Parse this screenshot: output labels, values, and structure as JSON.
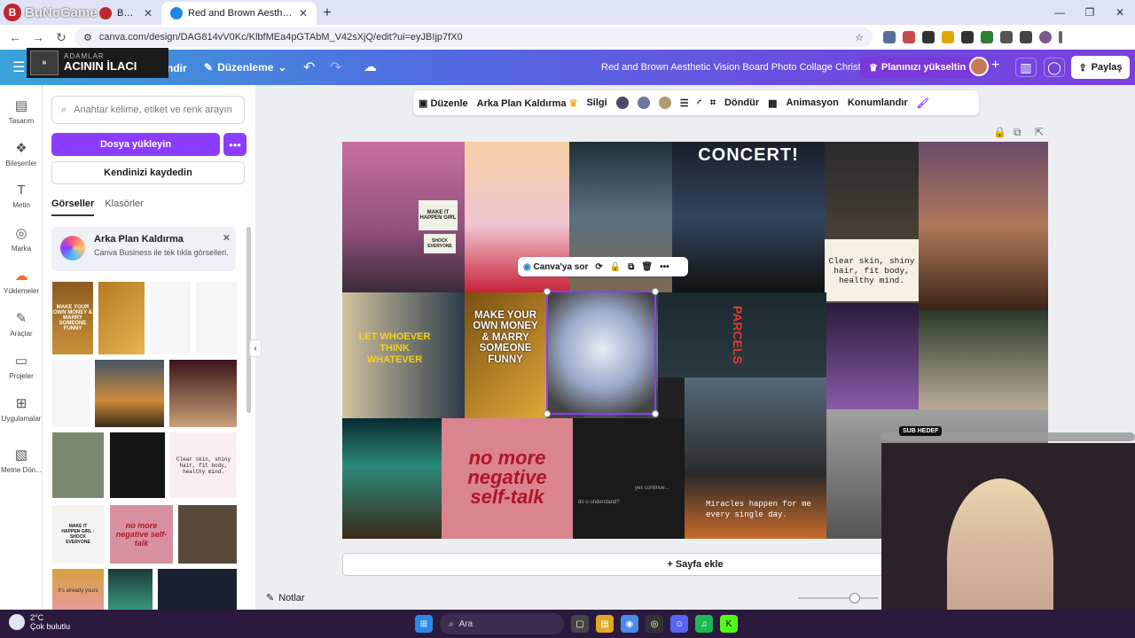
{
  "watermark": {
    "text": "BuNoGame"
  },
  "browser": {
    "tabs": [
      {
        "label": "BuNoGame",
        "active": false
      },
      {
        "label": "Red and Brown Aesthetic Vision",
        "active": true
      }
    ],
    "url": "canva.com/design/DAG814vV0Kc/KlbfMEa4pGTAbM_V42sXjQ/edit?ui=eyJBIjp7fX0"
  },
  "overlay": {
    "small": "ADAMLAR",
    "big": "ACININ İLACI"
  },
  "canva_top": {
    "file_label": "ndir",
    "edit_label": "Düzenleme",
    "doc_title": "Red and Brown Aesthetic Vision Board Photo Collage Christ...",
    "upgrade_label": "Planınızı yükseltin",
    "share_label": "Paylaş"
  },
  "rail": {
    "items": [
      {
        "label": "Tasarım",
        "icon": "design-icon"
      },
      {
        "label": "Bileşenler",
        "icon": "elements-icon"
      },
      {
        "label": "Metin",
        "icon": "text-icon"
      },
      {
        "label": "Marka",
        "icon": "brand-icon"
      },
      {
        "label": "Yüklemeler",
        "icon": "uploads-icon"
      },
      {
        "label": "Araçlar",
        "icon": "tools-icon"
      },
      {
        "label": "Projeler",
        "icon": "projects-icon"
      },
      {
        "label": "Uygulamalar",
        "icon": "apps-icon"
      },
      {
        "label": "Metne Dön...",
        "icon": "text-convert-icon"
      }
    ]
  },
  "panel": {
    "search_placeholder": "Anahtar kelime, etiket ve renk arayın",
    "upload_label": "Dosya yükleyin",
    "save_label": "Kendinizi kaydedin",
    "tabs": [
      "Görseller",
      "Klasörler"
    ],
    "promo": {
      "title": "Arka Plan Kaldırma",
      "subtitle": "Canva Business ile tek tıkla görselleri..."
    },
    "thumb_texts": {
      "money": "MAKE YOUR OWN MONEY & MARRY SOMEONE FUNNY",
      "clear": "Clear skin, shiny hair, fit body, healthy mind.",
      "sign": "MAKE IT HAPPEN GIRL · SHOCK EVERYONE",
      "neg": "no more negative self-talk",
      "yes": "It's already yours"
    }
  },
  "toolbar": {
    "edit_label": "Düzenle",
    "bg_remove_label": "Arka Plan Kaldırma",
    "eraser_label": "Silgi",
    "rotate_label": "Döndür",
    "animate_label": "Animasyon",
    "position_label": "Konumlandır",
    "colors": [
      "#4a4a6a",
      "#6a78a0",
      "#b09a70"
    ]
  },
  "canvas": {
    "texts": {
      "concert": "CONCERT!",
      "clear": "Clear skin, shiny hair, fit body, healthy mind.",
      "makeit": "MAKE IT HAPPEN GIRL",
      "shock": "SHOCK EVERYONE",
      "letwhoever": "LET WHOEVER THINK WHATEVER",
      "money": "MAKE YOUR OWN MONEY & MARRY SOMEONE FUNNY",
      "parcels": "PARCELS",
      "negative": "no more negative self-talk",
      "understand": "do u understand?",
      "continue": "yes continue...",
      "miracles": "Miracles happen for me every single day."
    },
    "context_bar_label": "Canva'ya sor",
    "add_page_label": "+ Sayfa ekle",
    "notes_label": "Notlar"
  },
  "stream": {
    "sub_goal_label": "SUB HEDEF"
  },
  "taskbar": {
    "temp": "2°C",
    "weather_text": "Çok bulutlu",
    "search_label": "Ara"
  }
}
